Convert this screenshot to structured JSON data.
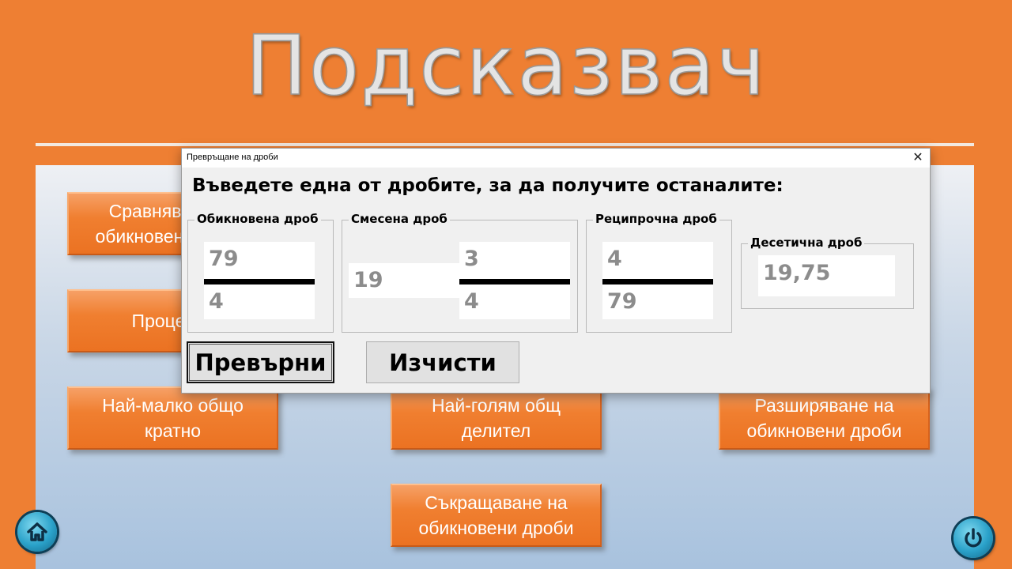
{
  "slide": {
    "title": "Подсказвач",
    "buttons": [
      {
        "label": "Сравняване на\nобикновени дроби"
      },
      {
        "label": "Проценти"
      },
      {
        "label": "Най-малко общо\nкратно"
      },
      {
        "label": "Най-голям общ\nделител"
      },
      {
        "label": "Разширяване на\nобикновени дроби"
      },
      {
        "label": "Съкращаване на\nобикновени дроби"
      }
    ],
    "home_icon": "home-icon",
    "power_icon": "power-icon"
  },
  "dialog": {
    "title": "Превръщане на дроби",
    "close_icon": "close-icon",
    "prompt": "Въведете една от дробите, за да получите останалите:",
    "common": {
      "label": "Обикновена дроб",
      "numerator": "79",
      "denominator": "4"
    },
    "mixed": {
      "label": "Смесена дроб",
      "whole": "19",
      "numerator": "3",
      "denominator": "4"
    },
    "reciprocal": {
      "label": "Реципрочна дроб",
      "numerator": "4",
      "denominator": "79"
    },
    "decimal": {
      "label": "Десетична дроб",
      "value": "19,75"
    },
    "convert_label": "Превърни",
    "clear_label": "Изчисти"
  },
  "colors": {
    "background": "#ee7f33",
    "button": "#f07f30",
    "panel": "#a8c2de",
    "round_button": "#2aa1c9"
  }
}
